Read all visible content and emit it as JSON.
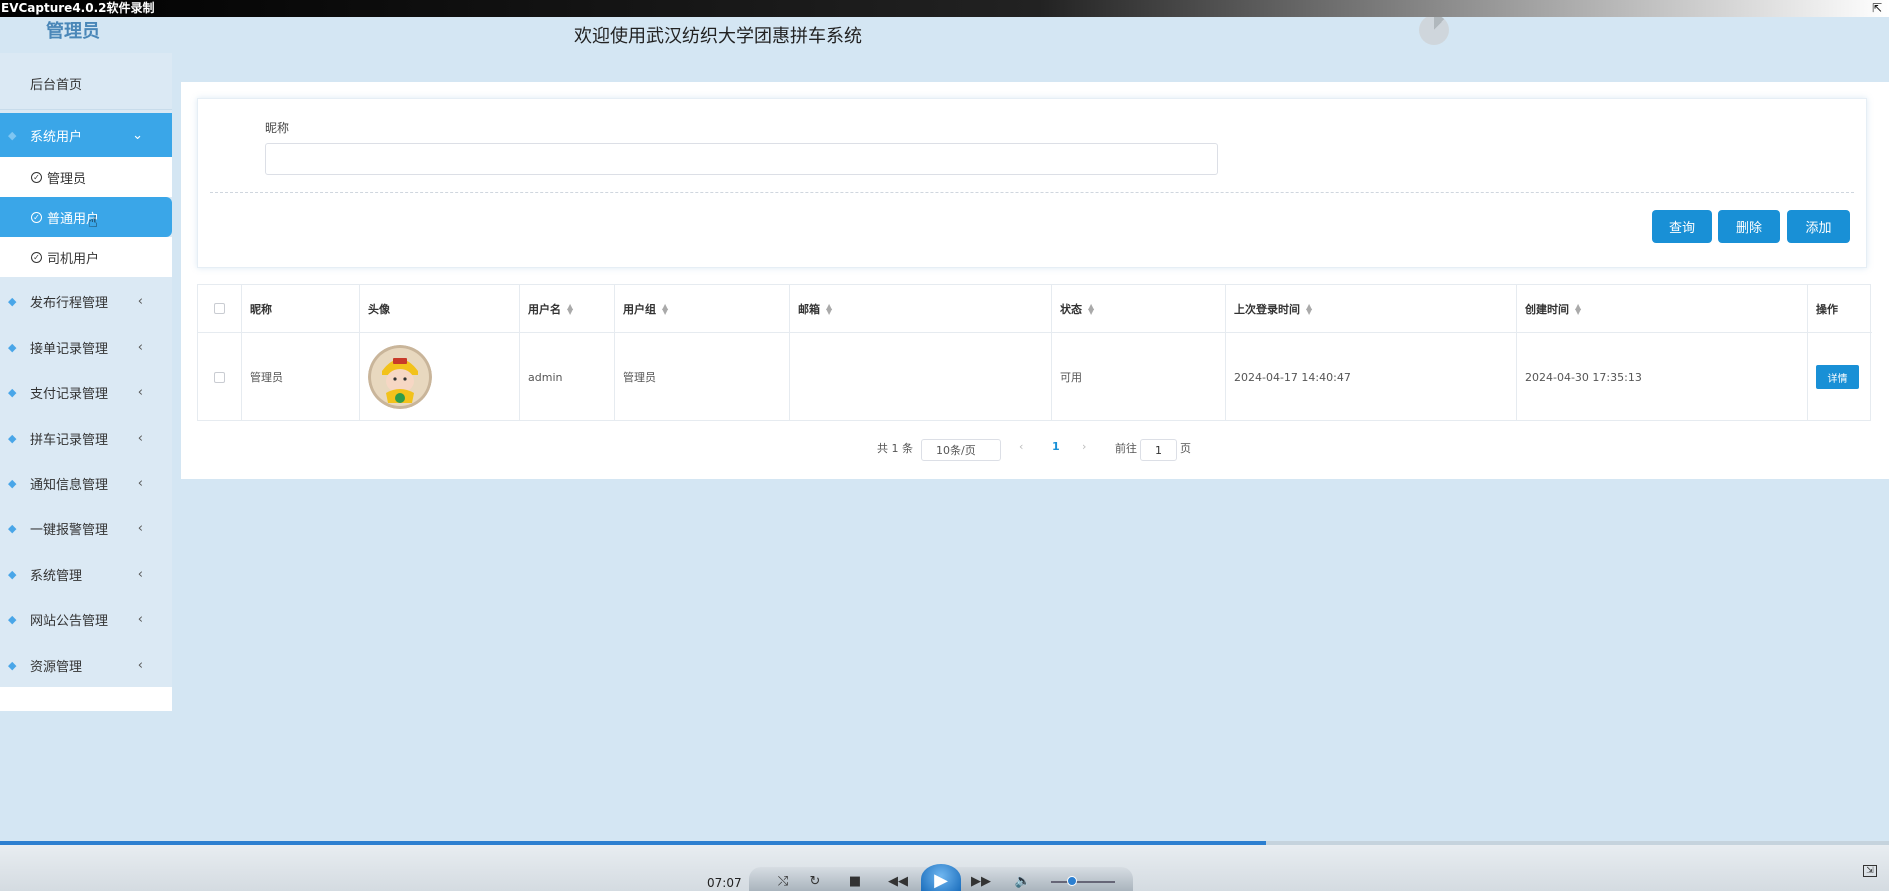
{
  "recorder": {
    "title": "EVCapture4.0.2软件录制",
    "corner_icon": "fullscreen-toggle-icon",
    "time": "07:07",
    "progress_fraction": 0.67,
    "volume_fraction": 0.28
  },
  "header": {
    "role": "管理员",
    "title": "欢迎使用武汉纺织大学团惠拼车系统"
  },
  "sidebar": {
    "home": "后台首页",
    "system_users": {
      "label": "系统用户",
      "subitems": [
        "管理员",
        "普通用户",
        "司机用户"
      ],
      "active_sub": "普通用户"
    },
    "items": [
      "发布行程管理",
      "接单记录管理",
      "支付记录管理",
      "拼车记录管理",
      "通知信息管理",
      "一键报警管理",
      "系统管理",
      "网站公告管理",
      "资源管理"
    ]
  },
  "search": {
    "label": "昵称",
    "value": "",
    "placeholder": ""
  },
  "buttons": {
    "query": "查询",
    "delete": "删除",
    "add": "添加"
  },
  "table": {
    "headers": [
      "昵称",
      "头像",
      "用户名",
      "用户组",
      "邮箱",
      "状态",
      "上次登录时间",
      "创建时间",
      "操作"
    ],
    "rows": [
      {
        "nickname": "管理员",
        "username": "admin",
        "group": "管理员",
        "email": "",
        "status": "可用",
        "last_login": "2024-04-17 14:40:47",
        "created": "2024-04-30 17:35:13",
        "action": "详情"
      }
    ]
  },
  "pagination": {
    "total": "共 1 条",
    "page_size": "10条/页",
    "current": "1",
    "goto_prefix": "前往",
    "goto_value": "1",
    "goto_suffix": "页"
  },
  "colors": {
    "accent": "#1990d6",
    "sidebar_active": "#3aa6e8",
    "background": "#d4e6f3"
  }
}
